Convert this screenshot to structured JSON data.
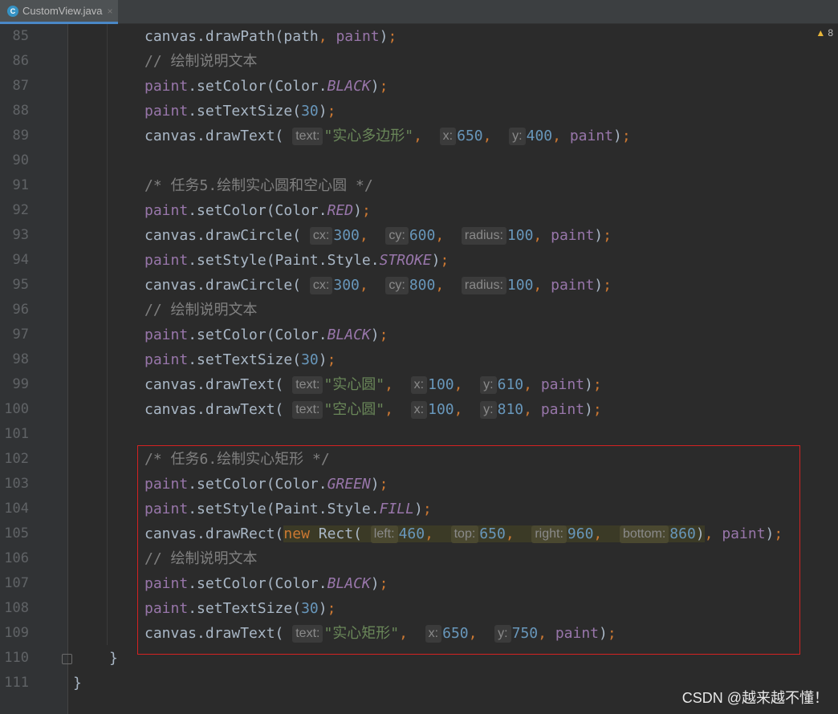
{
  "tab": {
    "filename": "CustomView.java",
    "icon_letter": "C",
    "close_glyph": "×",
    "icon": "java-class-icon"
  },
  "inspection": {
    "warning_count": "8",
    "icon": "warning-triangle-icon"
  },
  "watermark": "CSDN @越来越不懂！",
  "highlight_box_color": "#d42222",
  "lines": [
    {
      "n": "85",
      "tokens": [
        [
          "fn",
          "canvas.drawPath(path"
        ],
        [
          "punc",
          ", "
        ],
        [
          "var",
          "paint"
        ],
        [
          "fn",
          ")"
        ],
        [
          "punc",
          ";"
        ]
      ]
    },
    {
      "n": "86",
      "tokens": [
        [
          "cmt",
          "// 绘制说明文本"
        ]
      ]
    },
    {
      "n": "87",
      "tokens": [
        [
          "var",
          "paint"
        ],
        [
          "fn",
          ".setColor(Color."
        ],
        [
          "const",
          "BLACK"
        ],
        [
          "fn",
          ")"
        ],
        [
          "punc",
          ";"
        ]
      ]
    },
    {
      "n": "88",
      "tokens": [
        [
          "var",
          "paint"
        ],
        [
          "fn",
          ".setTextSize("
        ],
        [
          "num",
          "30"
        ],
        [
          "fn",
          ")"
        ],
        [
          "punc",
          ";"
        ]
      ]
    },
    {
      "n": "89",
      "tokens": [
        [
          "fn",
          "canvas.drawText( "
        ],
        [
          "hint",
          "text:"
        ],
        [
          "str",
          "\"实心多边形\""
        ],
        [
          "punc",
          ",  "
        ],
        [
          "hint",
          "x:"
        ],
        [
          "num",
          "650"
        ],
        [
          "punc",
          ",  "
        ],
        [
          "hint",
          "y:"
        ],
        [
          "num",
          "400"
        ],
        [
          "punc",
          ", "
        ],
        [
          "var",
          "paint"
        ],
        [
          "fn",
          ")"
        ],
        [
          "punc",
          ";"
        ]
      ]
    },
    {
      "n": "90",
      "tokens": []
    },
    {
      "n": "91",
      "tokens": [
        [
          "cmt",
          "/* 任务5.绘制实心圆和空心圆 */"
        ]
      ]
    },
    {
      "n": "92",
      "tokens": [
        [
          "var",
          "paint"
        ],
        [
          "fn",
          ".setColor(Color."
        ],
        [
          "const",
          "RED"
        ],
        [
          "fn",
          ")"
        ],
        [
          "punc",
          ";"
        ]
      ]
    },
    {
      "n": "93",
      "tokens": [
        [
          "fn",
          "canvas.drawCircle( "
        ],
        [
          "hint",
          "cx:"
        ],
        [
          "num",
          "300"
        ],
        [
          "punc",
          ",  "
        ],
        [
          "hint",
          "cy:"
        ],
        [
          "num",
          "600"
        ],
        [
          "punc",
          ",  "
        ],
        [
          "hint",
          "radius:"
        ],
        [
          "num",
          "100"
        ],
        [
          "punc",
          ", "
        ],
        [
          "var",
          "paint"
        ],
        [
          "fn",
          ")"
        ],
        [
          "punc",
          ";"
        ]
      ]
    },
    {
      "n": "94",
      "tokens": [
        [
          "var",
          "paint"
        ],
        [
          "fn",
          ".setStyle(Paint.Style."
        ],
        [
          "const",
          "STROKE"
        ],
        [
          "fn",
          ")"
        ],
        [
          "punc",
          ";"
        ]
      ]
    },
    {
      "n": "95",
      "tokens": [
        [
          "fn",
          "canvas.drawCircle( "
        ],
        [
          "hint",
          "cx:"
        ],
        [
          "num",
          "300"
        ],
        [
          "punc",
          ",  "
        ],
        [
          "hint",
          "cy:"
        ],
        [
          "num",
          "800"
        ],
        [
          "punc",
          ",  "
        ],
        [
          "hint",
          "radius:"
        ],
        [
          "num",
          "100"
        ],
        [
          "punc",
          ", "
        ],
        [
          "var",
          "paint"
        ],
        [
          "fn",
          ")"
        ],
        [
          "punc",
          ";"
        ]
      ]
    },
    {
      "n": "96",
      "tokens": [
        [
          "cmt",
          "// 绘制说明文本"
        ]
      ]
    },
    {
      "n": "97",
      "tokens": [
        [
          "var",
          "paint"
        ],
        [
          "fn",
          ".setColor(Color."
        ],
        [
          "const",
          "BLACK"
        ],
        [
          "fn",
          ")"
        ],
        [
          "punc",
          ";"
        ]
      ]
    },
    {
      "n": "98",
      "tokens": [
        [
          "var",
          "paint"
        ],
        [
          "fn",
          ".setTextSize("
        ],
        [
          "num",
          "30"
        ],
        [
          "fn",
          ")"
        ],
        [
          "punc",
          ";"
        ]
      ]
    },
    {
      "n": "99",
      "tokens": [
        [
          "fn",
          "canvas.drawText( "
        ],
        [
          "hint",
          "text:"
        ],
        [
          "str",
          "\"实心圆\""
        ],
        [
          "punc",
          ",  "
        ],
        [
          "hint",
          "x:"
        ],
        [
          "num",
          "100"
        ],
        [
          "punc",
          ",  "
        ],
        [
          "hint",
          "y:"
        ],
        [
          "num",
          "610"
        ],
        [
          "punc",
          ", "
        ],
        [
          "var",
          "paint"
        ],
        [
          "fn",
          ")"
        ],
        [
          "punc",
          ";"
        ]
      ]
    },
    {
      "n": "100",
      "tokens": [
        [
          "fn",
          "canvas.drawText( "
        ],
        [
          "hint",
          "text:"
        ],
        [
          "str",
          "\"空心圆\""
        ],
        [
          "punc",
          ",  "
        ],
        [
          "hint",
          "x:"
        ],
        [
          "num",
          "100"
        ],
        [
          "punc",
          ",  "
        ],
        [
          "hint",
          "y:"
        ],
        [
          "num",
          "810"
        ],
        [
          "punc",
          ", "
        ],
        [
          "var",
          "paint"
        ],
        [
          "fn",
          ")"
        ],
        [
          "punc",
          ";"
        ]
      ]
    },
    {
      "n": "101",
      "tokens": []
    },
    {
      "n": "102",
      "tokens": [
        [
          "cmt",
          "/* 任务6.绘制实心矩形 */"
        ]
      ]
    },
    {
      "n": "103",
      "tokens": [
        [
          "var",
          "paint"
        ],
        [
          "fn",
          ".setColor(Color."
        ],
        [
          "const",
          "GREEN"
        ],
        [
          "fn",
          ")"
        ],
        [
          "punc",
          ";"
        ]
      ]
    },
    {
      "n": "104",
      "tokens": [
        [
          "var",
          "paint"
        ],
        [
          "fn",
          ".setStyle(Paint.Style."
        ],
        [
          "const",
          "FILL"
        ],
        [
          "fn",
          ")"
        ],
        [
          "punc",
          ";"
        ]
      ]
    },
    {
      "n": "105",
      "tokens": [
        [
          "fn",
          "canvas.drawRect("
        ],
        [
          "hl:kw",
          "new "
        ],
        [
          "hl:fn",
          "Rect( "
        ],
        [
          "hl:hint",
          "left:"
        ],
        [
          "hl:num",
          "460"
        ],
        [
          "hl:punc",
          ",  "
        ],
        [
          "hl:hint",
          "top:"
        ],
        [
          "hl:num",
          "650"
        ],
        [
          "hl:punc",
          ",  "
        ],
        [
          "hl:hint",
          "right:"
        ],
        [
          "hl:num",
          "960"
        ],
        [
          "hl:punc",
          ",  "
        ],
        [
          "hl:hint",
          "bottom:"
        ],
        [
          "hl:num",
          "860"
        ],
        [
          "hl:fn",
          ")"
        ],
        [
          "punc",
          ", "
        ],
        [
          "var",
          "paint"
        ],
        [
          "fn",
          ")"
        ],
        [
          "punc",
          ";"
        ]
      ]
    },
    {
      "n": "106",
      "tokens": [
        [
          "cmt",
          "// 绘制说明文本"
        ]
      ]
    },
    {
      "n": "107",
      "tokens": [
        [
          "var",
          "paint"
        ],
        [
          "fn",
          ".setColor(Color."
        ],
        [
          "const",
          "BLACK"
        ],
        [
          "fn",
          ")"
        ],
        [
          "punc",
          ";"
        ]
      ]
    },
    {
      "n": "108",
      "tokens": [
        [
          "var",
          "paint"
        ],
        [
          "fn",
          ".setTextSize("
        ],
        [
          "num",
          "30"
        ],
        [
          "fn",
          ")"
        ],
        [
          "punc",
          ";"
        ]
      ]
    },
    {
      "n": "109",
      "tokens": [
        [
          "fn",
          "canvas.drawText( "
        ],
        [
          "hint",
          "text:"
        ],
        [
          "str",
          "\"实心矩形\""
        ],
        [
          "punc",
          ",  "
        ],
        [
          "hint",
          "x:"
        ],
        [
          "num",
          "650"
        ],
        [
          "punc",
          ",  "
        ],
        [
          "hint",
          "y:"
        ],
        [
          "num",
          "750"
        ],
        [
          "punc",
          ", "
        ],
        [
          "var",
          "paint"
        ],
        [
          "fn",
          ")"
        ],
        [
          "punc",
          ";"
        ]
      ]
    },
    {
      "n": "110",
      "tokens": [
        [
          "fn",
          "}"
        ]
      ]
    },
    {
      "n": "111",
      "tokens": [
        [
          "fn",
          "}"
        ]
      ]
    }
  ]
}
